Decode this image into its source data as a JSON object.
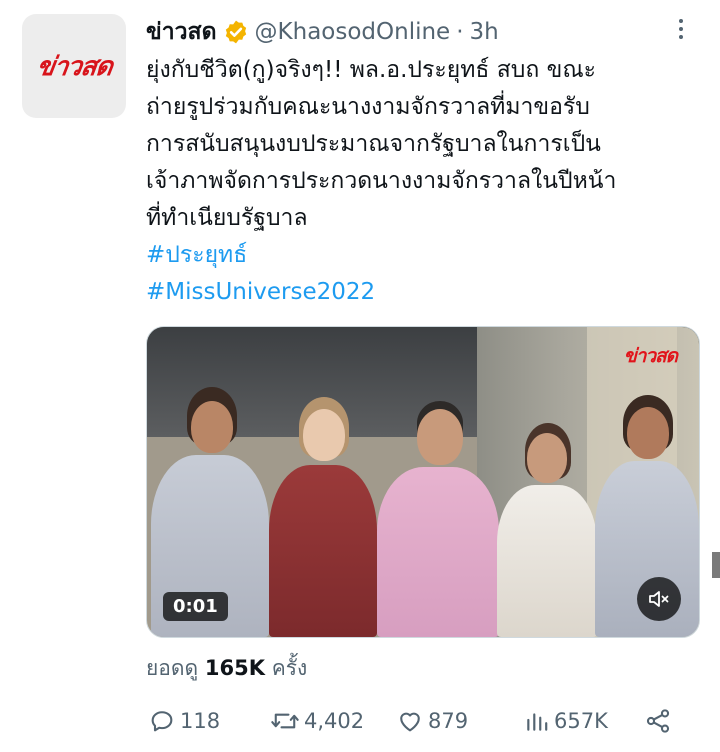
{
  "author": {
    "avatar_text": "ข่าวสด",
    "display_name": "ข่าวสด",
    "handle": "@KhaosodOnline",
    "separator": "·",
    "time": "3h"
  },
  "tweet": {
    "lines": [
      "ยุ่งกับชีวิต(กู)จริงๆ!! พล.อ.ประยุทธ์ สบถ ขณะ",
      "ถ่ายรูปร่วมกับคณะนางงามจักรวาลที่มาขอรับ",
      "การสนับสนุนงบประมาณจากรัฐบาลในการเป็น",
      "เจ้าภาพจัดการประกวดนางงามจักรวาลในปีหน้า",
      "ที่ทำเนียบรัฐบาล"
    ],
    "hashtags": [
      "#ประยุทธ์",
      "#MissUniverse2022"
    ]
  },
  "media": {
    "watermark": "ข่าวสด",
    "video_time": "0:01"
  },
  "views": {
    "label": "ยอดดู",
    "count": "165K",
    "suffix": "ครั้ง"
  },
  "actions": {
    "replies": "118",
    "retweets": "4,402",
    "likes": "879",
    "views": "657K"
  },
  "colors": {
    "link": "#1d9bf0",
    "verified": "#f4b400",
    "brand_red": "#d8141b",
    "secondary_text": "#536471"
  }
}
